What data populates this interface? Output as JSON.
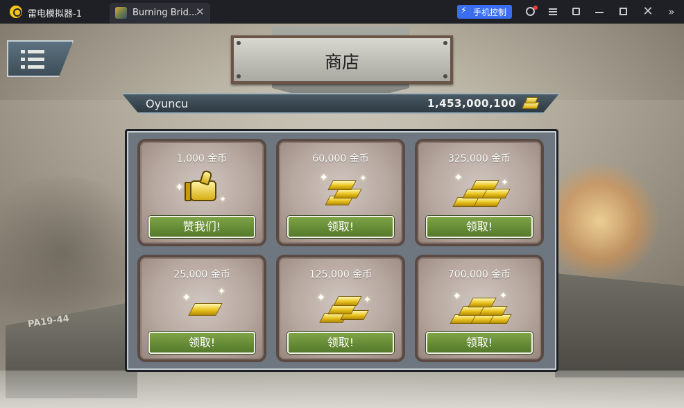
{
  "window": {
    "app_name": "雷电模拟器-1",
    "tab_title": "Burning Brid...",
    "phone_control_label": "手机控制"
  },
  "game": {
    "title": "商店",
    "player_name": "Oyuncu",
    "player_coins": "1,453,000,100",
    "boat_marking": "PA19-44",
    "shop_items": [
      {
        "amount": "1,000 金币",
        "button": "赞我们!",
        "icon": "thumbs-up"
      },
      {
        "amount": "60,000 金币",
        "button": "领取!",
        "icon": "gold-bars-small"
      },
      {
        "amount": "325,000 金币",
        "button": "领取!",
        "icon": "gold-bars-large"
      },
      {
        "amount": "25,000 金币",
        "button": "领取!",
        "icon": "gold-bar-single"
      },
      {
        "amount": "125,000 金币",
        "button": "领取!",
        "icon": "gold-bars-medium"
      },
      {
        "amount": "700,000 金币",
        "button": "领取!",
        "icon": "gold-bars-pile"
      }
    ]
  },
  "colors": {
    "accent_blue": "#3a6df0",
    "button_green": "#6a8f38",
    "gold": "#e8c21c"
  }
}
